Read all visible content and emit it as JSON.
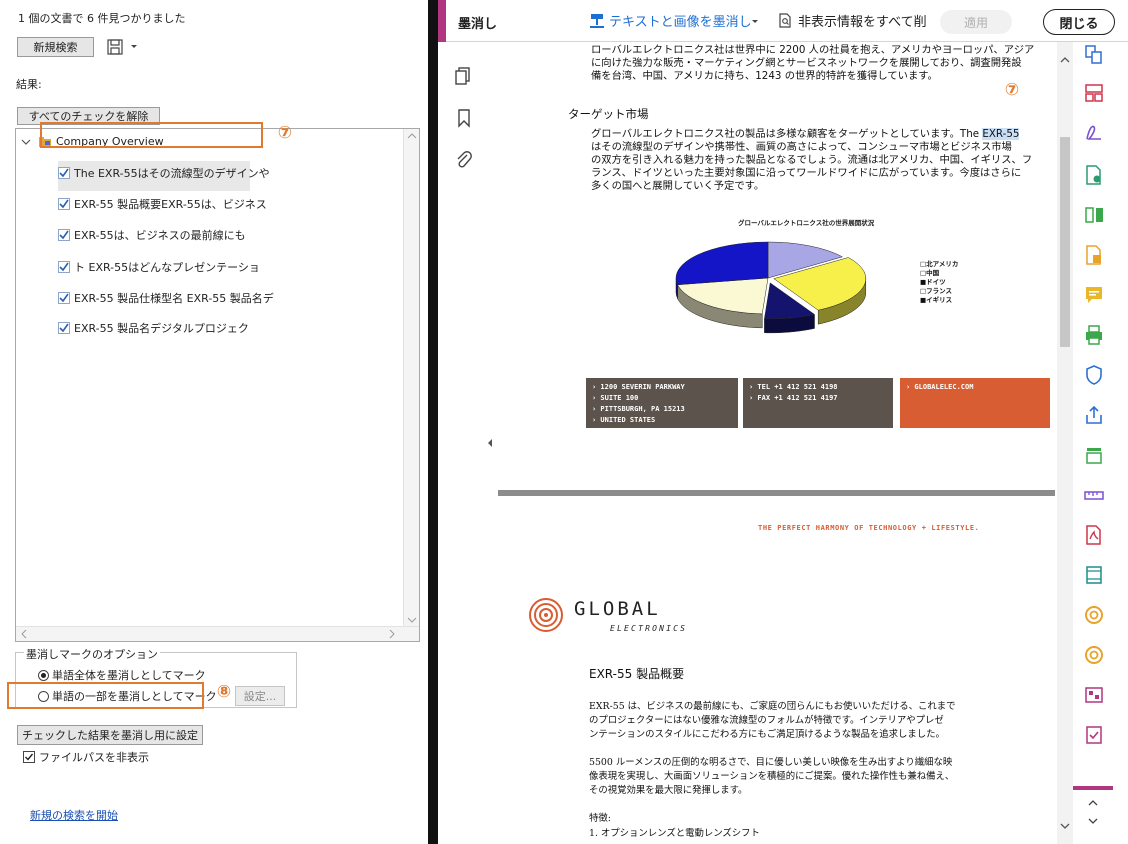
{
  "search_panel": {
    "summary": "1 個の文書で 6 件見つかりました",
    "new_search_label": "新規検索",
    "results_label": "結果:",
    "uncheck_all_label": "すべてのチェックを解除",
    "tree": {
      "root_label": "Company Overview",
      "items": [
        "The EXR-55はその流線型のデザインや",
        "EXR-55 製品概要EXR-55は、ビジネス",
        "EXR-55は、ビジネスの最前線にも",
        "ト EXR-55はどんなプレゼンテーショ",
        "EXR-55 製品仕様型名 EXR-55 製品名デ",
        "EXR-55 製品名デジタルプロジェク"
      ]
    },
    "options_title": "墨消しマークのオプション",
    "option_whole": "単語全体を墨消しとしてマーク",
    "option_partial": "単語の一部を墨消しとしてマーク",
    "settings_label": "設定...",
    "apply_checked_label": "チェックした結果を墨消し用に設定",
    "hide_path_label": "ファイルパスを非表示",
    "new_search_link": "新規の検索を開始",
    "annotations": [
      "⑦",
      "⑧"
    ]
  },
  "toolbar": {
    "title": "墨消し",
    "redact_text_image": "テキストと画像を墨消し",
    "remove_hidden": "非表示情報をすべて削",
    "apply": "適用",
    "close": "閉じる"
  },
  "document": {
    "page1": {
      "intro_lines": [
        "ローバルエレクトロニクス社は世界中に 2200 人の社員を抱え、アメリカやヨーロッパ、アジア",
        "に向けた強力な販売・マーケティング網とサービスネットワークを展開しており、調査開発設",
        "備を台湾、中国、アメリカに持ち、1243 の世界的特許を獲得しています。"
      ],
      "annotation": "⑦",
      "section_title": "ターゲット市場",
      "target_line1_pre": "グローバルエレクトロニクス社の製品は多様な顧客をターゲットとしています。The ",
      "target_line1_hl": "EXR-55",
      "target_lines": [
        "はその流線型のデザインや携帯性、画質の高さによって、コンシューマ市場とビジネス市場",
        "の双方を引き入れる魅力を持った製品となるでしょう。流通は北アメリカ、中国、イギリス、フ",
        "ランス、ドイツといった主要対象国に沿ってワールドワイドに広がっています。今度はさらに",
        "多くの国へと展開していく予定です。"
      ],
      "info_address": [
        "› 1200 SEVERIN PARKWAY",
        "› SUITE 100",
        "› PITTSBURGH, PA 15213",
        "› UNITED STATES"
      ],
      "info_phone": [
        "› TEL +1 412 521 4198",
        "› FAX +1 412 521 4197"
      ],
      "info_web": "› GLOBALELEC.COM"
    },
    "page2": {
      "tagline": "THE PERFECT HARMONY OF TECHNOLOGY + LIFESTYLE.",
      "logo_main": "GLOBAL",
      "logo_sub": "ELECTRONICS",
      "heading": "EXR-55 製品概要",
      "para1": [
        "EXR-55 は、ビジネスの最前線にも、ご家庭の団らんにもお使いいただける、これまで",
        "のプロジェクターにはない優雅な流線型のフォルムが特徴です。インテリアやプレゼ",
        "ンテーションのスタイルにこだわる方にもご満足頂けるような製品を追求しました。"
      ],
      "para2": [
        "5500 ルーメンスの圧倒的な明るさで、目に優しい美しい映像を生み出すより繊細な映",
        "像表現を実現し、大画面ソリューションを積極的にご提案。優れた操作性も兼ね備え、",
        "その視覚効果を最大限に発揮します。"
      ],
      "features_label": "特徴:",
      "feature1": "1. オプションレンズと電動レンズシフト"
    }
  },
  "chart_data": {
    "type": "pie",
    "title": "グローバルエレクトロニクス社の世界展開状況",
    "categories": [
      "北アメリカ",
      "中国",
      "ドイツ",
      "フランス",
      "イギリス"
    ],
    "legend_markers": [
      "□",
      "□",
      "■",
      "□",
      "■"
    ],
    "values": [
      15,
      27,
      9,
      21,
      28
    ],
    "colors": [
      "#a9a6e6",
      "#f7f04a",
      "#14146e",
      "#fbf8d4",
      "#1515c8"
    ],
    "legend": "right"
  },
  "colors": {
    "accent": "#b0367f",
    "annotation": "#e07a2e",
    "link": "#1a4fb3",
    "toolbar_blue": "#1d6fd1"
  }
}
